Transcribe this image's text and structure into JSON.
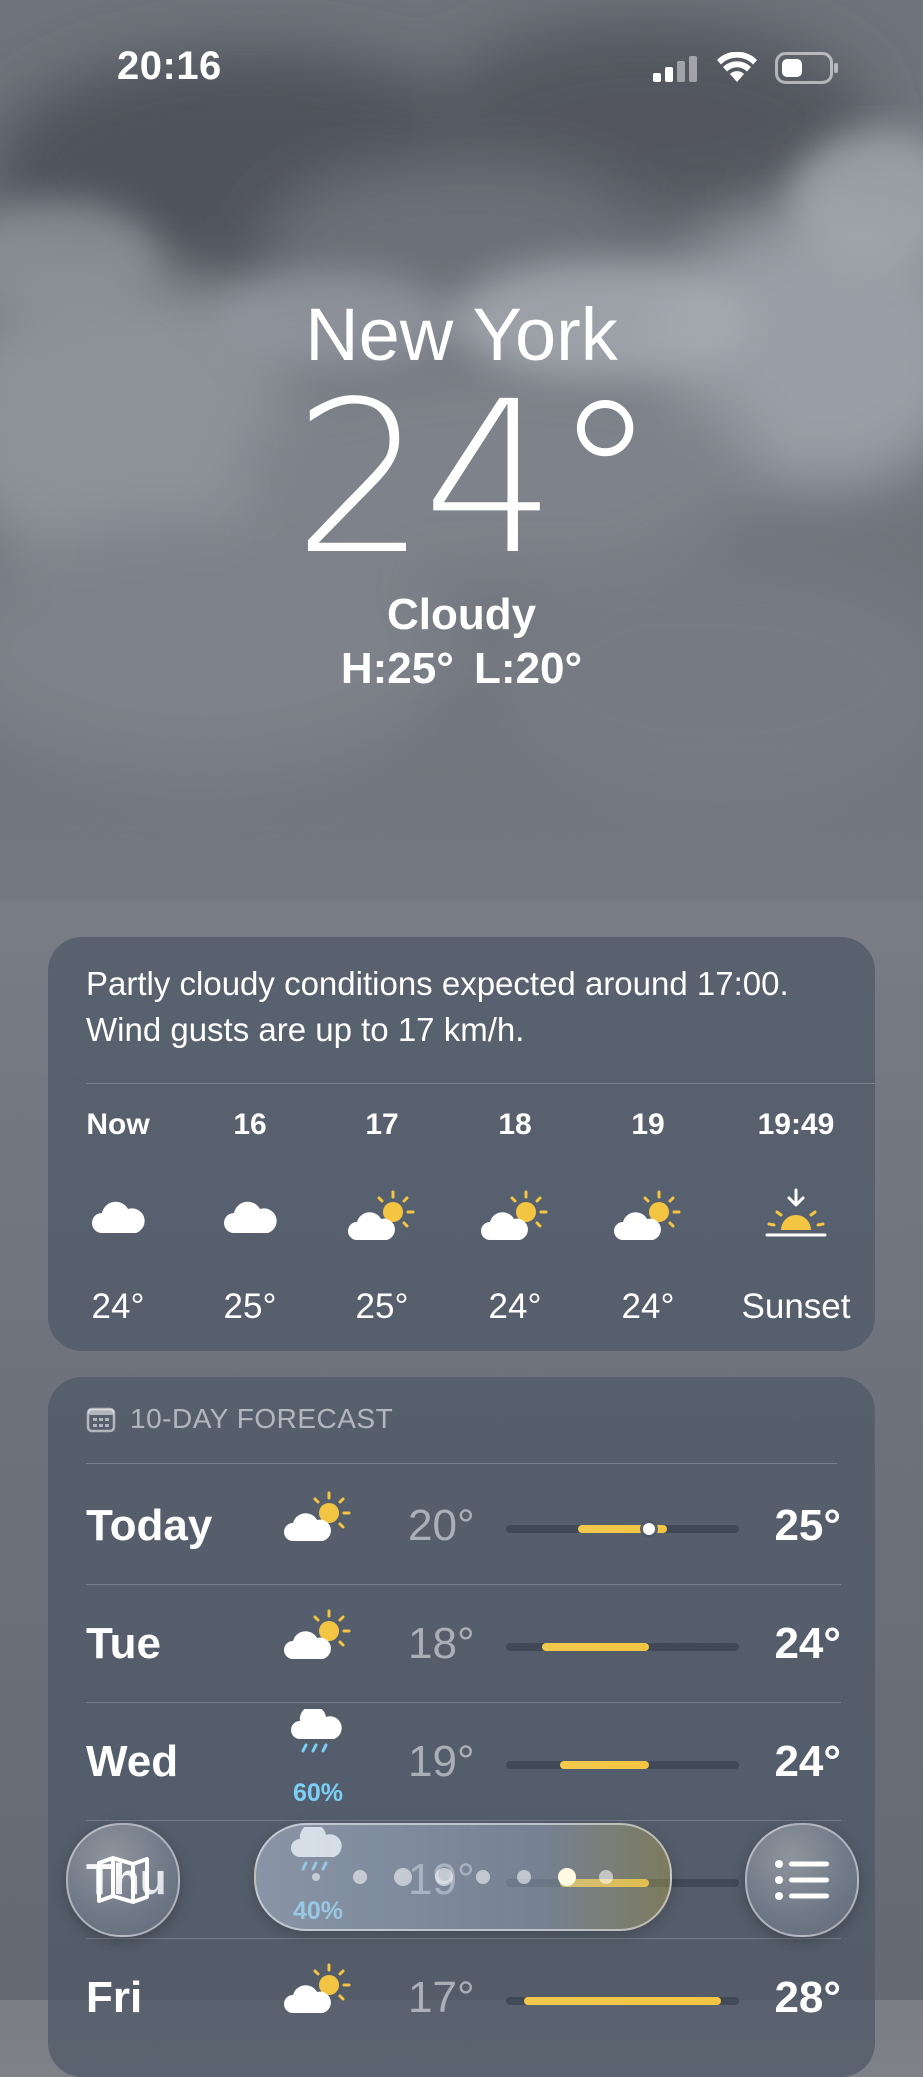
{
  "status": {
    "time": "20:16"
  },
  "hero": {
    "city": "New York",
    "temperature": "24°",
    "condition": "Cloudy",
    "high_low": "H:25°  L:20°"
  },
  "hourly": {
    "summary": "Partly cloudy conditions expected around 17:00. Wind gusts are up to 17 km/h.",
    "items": [
      {
        "label": "Now",
        "icon": "cloud-icon",
        "temp": "24°"
      },
      {
        "label": "16",
        "icon": "cloud-icon",
        "temp": "25°"
      },
      {
        "label": "17",
        "icon": "partly-sunny-icon",
        "temp": "25°"
      },
      {
        "label": "18",
        "icon": "partly-sunny-icon",
        "temp": "24°"
      },
      {
        "label": "19",
        "icon": "partly-sunny-icon",
        "temp": "24°"
      },
      {
        "label": "19:49",
        "icon": "sunset-icon",
        "temp": "Sunset"
      }
    ]
  },
  "forecast": {
    "header": "10-DAY FORECAST",
    "days": [
      {
        "day": "Today",
        "icon": "partly-sunny-icon",
        "precip": "",
        "low": "20°",
        "high": "25°",
        "range": [
          20,
          25
        ],
        "current": 24
      },
      {
        "day": "Tue",
        "icon": "partly-sunny-icon",
        "precip": "",
        "low": "18°",
        "high": "24°",
        "range": [
          18,
          24
        ]
      },
      {
        "day": "Wed",
        "icon": "rain-cloud-icon",
        "precip": "60%",
        "low": "19°",
        "high": "24°",
        "range": [
          19,
          24
        ]
      },
      {
        "day": "Thu",
        "icon": "rain-cloud-icon",
        "precip": "40%",
        "low": "19°",
        "high": "",
        "range": [
          19,
          24
        ]
      },
      {
        "day": "Fri",
        "icon": "partly-sunny-icon",
        "precip": "",
        "low": "17°",
        "high": "28°",
        "range": [
          17,
          28
        ]
      }
    ],
    "scale_min": 16,
    "scale_max": 29
  },
  "bottom": {
    "map_icon": "map-icon",
    "list_icon": "list-icon",
    "page_count": 8,
    "active_page": 7
  },
  "colors": {
    "accent_sun": "#f4c542",
    "precip_blue": "#7cd0f5"
  }
}
